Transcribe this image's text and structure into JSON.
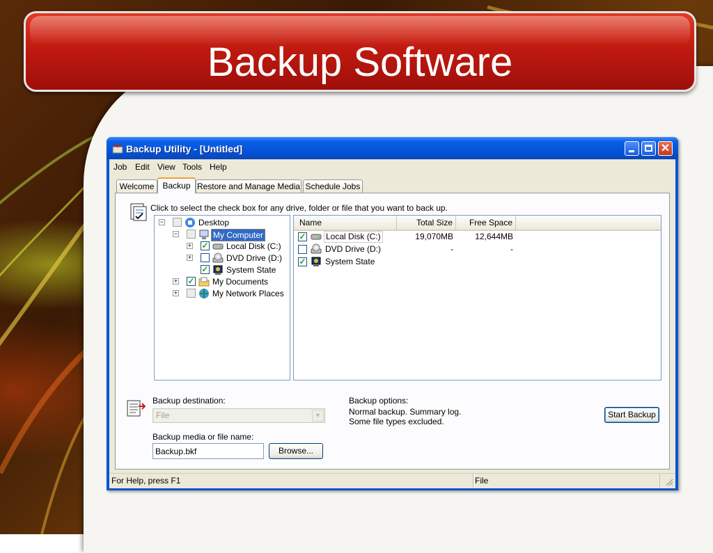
{
  "slide": {
    "title": "Backup Software"
  },
  "window": {
    "title": "Backup Utility - [Untitled]",
    "menu": [
      "Job",
      "Edit",
      "View",
      "Tools",
      "Help"
    ],
    "tabs": [
      "Welcome",
      "Backup",
      "Restore and Manage Media",
      "Schedule Jobs"
    ],
    "active_tab": "Backup",
    "instructions": "Click to select the check box for any drive, folder or file that you want to back up.",
    "tree": [
      {
        "label": "Desktop",
        "icon": "desktop-icon",
        "expander": "minus",
        "checked": false
      },
      {
        "label": "My Computer",
        "icon": "computer-icon",
        "expander": "minus",
        "checked": false,
        "selected": true
      },
      {
        "label": "Local Disk (C:)",
        "icon": "hard-disk-icon",
        "expander": "plus",
        "checked": true
      },
      {
        "label": "DVD Drive (D:)",
        "icon": "dvd-drive-icon",
        "expander": "plus",
        "checked": false
      },
      {
        "label": "System State",
        "icon": "system-state-icon",
        "expander": "",
        "checked": true
      },
      {
        "label": "My Documents",
        "icon": "folder-icon",
        "expander": "plus",
        "checked": true
      },
      {
        "label": "My Network Places",
        "icon": "network-icon",
        "expander": "plus",
        "checked": false
      }
    ],
    "list": {
      "columns": [
        "Name",
        "Total Size",
        "Free Space"
      ],
      "rows": [
        {
          "name": "Local Disk (C:)",
          "total": "19,070MB",
          "free": "12,644MB",
          "checked": true,
          "icon": "hard-disk-icon"
        },
        {
          "name": "DVD Drive (D:)",
          "total": "-",
          "free": "-",
          "checked": false,
          "icon": "dvd-drive-icon"
        },
        {
          "name": "System State",
          "total": "",
          "free": "",
          "checked": true,
          "icon": "system-state-icon"
        }
      ]
    },
    "destination_label": "Backup destination:",
    "destination_value": "File",
    "media_label": "Backup media or file name:",
    "media_value": "Backup.bkf",
    "browse_label": "Browse...",
    "options_label": "Backup options:",
    "options_line1": "Normal backup.  Summary log.",
    "options_line2": "Some file types excluded.",
    "start_label": "Start Backup",
    "status_left": "For Help, press F1",
    "status_right": "File"
  },
  "colors": {
    "title_banner": "#c11a10",
    "titlebar": "#0451d6",
    "selection": "#316ac5"
  }
}
